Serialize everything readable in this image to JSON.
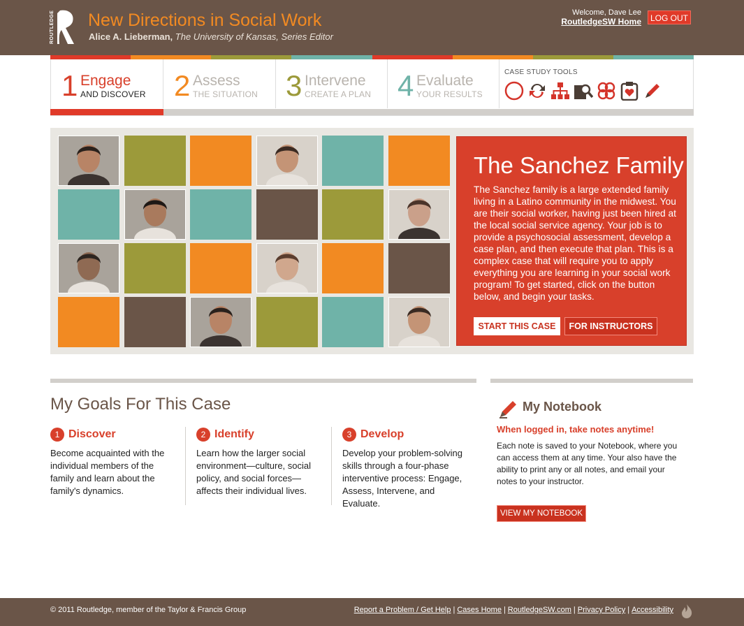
{
  "header": {
    "logo_text": "ROUTLEDGE",
    "title": "New Directions in Social Work",
    "subtitle_name": "Alice A. Lieberman,",
    "subtitle_rest": "The University of Kansas, Series Editor",
    "welcome": "Welcome, Dave Lee",
    "home_link": "RoutledgeSW Home",
    "logout": "LOG OUT"
  },
  "stripe_colors": [
    "#e03a29",
    "#f28a22",
    "#9c9a3a",
    "#6fb3a8",
    "#e03a29",
    "#f28a22",
    "#9c9a3a",
    "#6fb3a8"
  ],
  "steps": [
    {
      "num": "1",
      "name": "Engage",
      "sub": "AND DISCOVER",
      "color": "#d8402b",
      "active": true
    },
    {
      "num": "2",
      "name": "Assess",
      "sub": "THE SITUATION",
      "color": "#f28a22",
      "active": false
    },
    {
      "num": "3",
      "name": "Intervene",
      "sub": "CREATE A PLAN",
      "color": "#9c9a3a",
      "active": false
    },
    {
      "num": "4",
      "name": "Evaluate",
      "sub": "YOUR RESULTS",
      "color": "#6fb3a8",
      "active": false
    }
  ],
  "tools": {
    "label": "CASE STUDY TOOLS",
    "icons": [
      "compass-icon",
      "refresh-icon",
      "org-chart-icon",
      "search-folder-icon",
      "network-icon",
      "clipboard-icon",
      "pencil-icon"
    ]
  },
  "tiles": [
    [
      "photo",
      "#9c9a3a",
      "#f28a22",
      "photo",
      "#6fb3a8",
      "#f28a22"
    ],
    [
      "#6fb3a8",
      "photo",
      "#6fb3a8",
      "#6a5548",
      "#9c9a3a",
      "photo"
    ],
    [
      "photo",
      "#9c9a3a",
      "#f28a22",
      "photo",
      "#f28a22",
      "#6a5548"
    ],
    [
      "#f28a22",
      "#6a5548",
      "photo",
      "#9c9a3a",
      "#6fb3a8",
      "photo"
    ]
  ],
  "case": {
    "title": "The Sanchez Family",
    "description": "The Sanchez family is a large extended family living in a Latino community in the midwest. You are their social worker, having just been hired at the local social service agency. Your job is to provide a psychosocial assessment, develop a case plan, and then execute that plan. This is a complex case that will require you to apply everything you are learning in your social work program! To get started, click on the button below, and begin your tasks.",
    "start_button": "START THIS CASE",
    "instructor_button": "FOR INSTRUCTORS"
  },
  "goals": {
    "title": "My Goals For This Case",
    "items": [
      {
        "num": "1",
        "title": "Discover",
        "body": "Become acquainted with the individual members of the family and learn about the family's dynamics."
      },
      {
        "num": "2",
        "title": "Identify",
        "body": "Learn how the larger social environment—culture, social policy, and social forces—affects their individual lives."
      },
      {
        "num": "3",
        "title": "Develop",
        "body": "Develop your problem-solving skills through a four-phase interventive process: Engage, Assess, Intervene, and Evaluate."
      }
    ]
  },
  "notebook": {
    "title": "My Notebook",
    "subtitle": "When logged in, take notes anytime!",
    "body": "Each note is saved to your Notebook, where you can access them at any time. Your also have the ability to print any or all notes, and email your notes to your instructor.",
    "button": "VIEW MY NOTEBOOK"
  },
  "footer": {
    "copyright": "© 2011 Routledge, member of the Taylor & Francis Group",
    "links": [
      "Report a Problem / Get Help",
      "Cases Home",
      "RoutledgeSW.com",
      "Privacy Policy",
      "Accessibility"
    ]
  }
}
